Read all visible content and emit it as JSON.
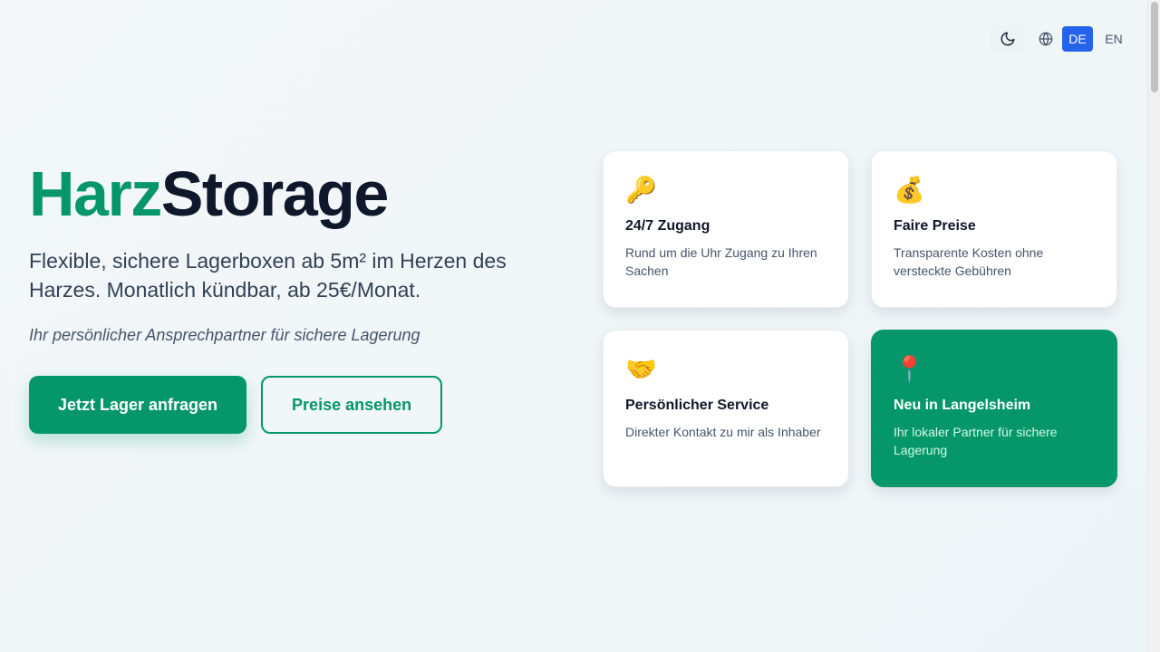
{
  "header": {
    "theme_icon": "moon-icon",
    "globe_icon": "globe-icon",
    "languages": [
      "DE",
      "EN"
    ],
    "active_language": "DE"
  },
  "hero": {
    "logo_part1": "Harz",
    "logo_part2": "Storage",
    "lead": "Flexible, sichere Lagerboxen ab 5m² im Herzen des Harzes. Monatlich kündbar, ab 25€/Monat.",
    "tagline": "Ihr persönlicher Ansprechpartner für sichere Lagerung",
    "primary_button": "Jetzt Lager anfragen",
    "secondary_button": "Preise ansehen"
  },
  "features": [
    {
      "icon": "key-icon",
      "emoji": "🔑",
      "title": "24/7 Zugang",
      "desc": "Rund um die Uhr Zugang zu Ihren Sachen"
    },
    {
      "icon": "money-bag-icon",
      "emoji": "💰",
      "title": "Faire Preise",
      "desc": "Transparente Kosten ohne versteckte Gebühren"
    },
    {
      "icon": "handshake-icon",
      "emoji": "🤝",
      "title": "Persönlicher Service",
      "desc": "Direkter Kontakt zu mir als Inhaber"
    },
    {
      "icon": "pin-icon",
      "emoji": "📍",
      "title": "Neu in Langelsheim",
      "desc": "Ihr lokaler Partner für sichere Lagerung"
    }
  ],
  "colors": {
    "brand_green": "#059669",
    "dark": "#0f172a",
    "active_lang_bg": "#2563eb"
  }
}
